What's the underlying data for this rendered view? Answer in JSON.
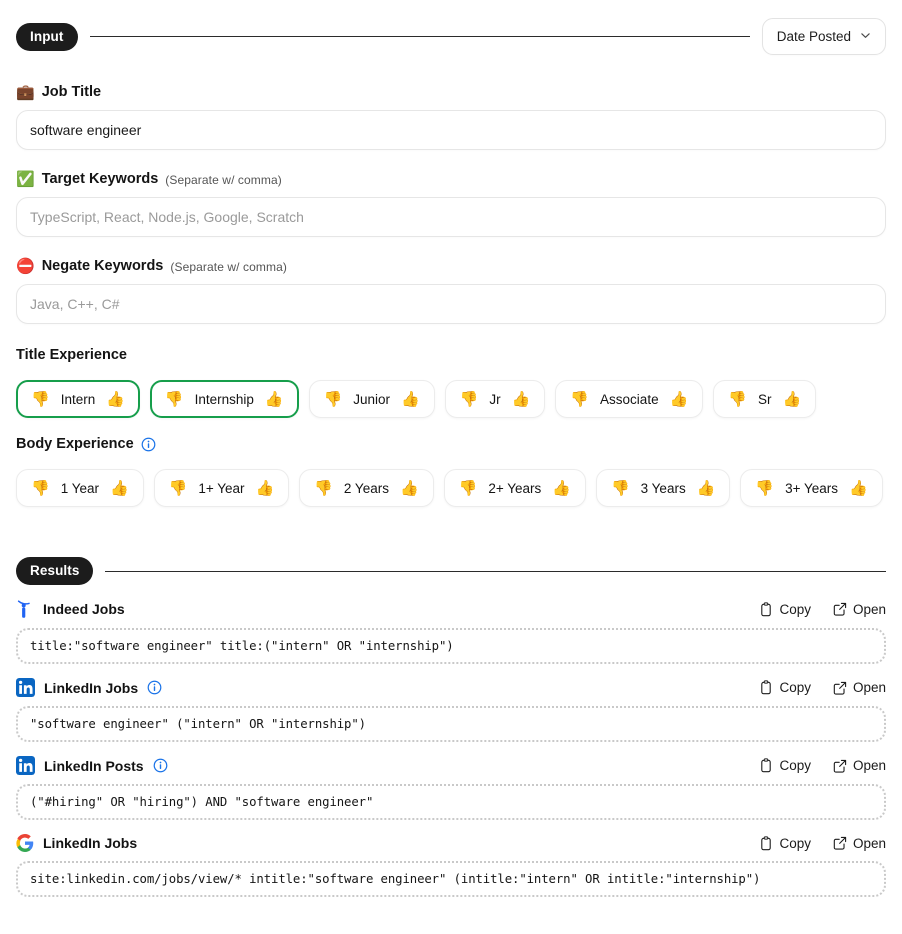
{
  "input_section": {
    "badge": "Input",
    "date_posted": {
      "label": "Date Posted",
      "icon": "chevron-down-icon"
    }
  },
  "fields": {
    "job_title": {
      "emoji": "💼",
      "label": "Job Title",
      "value": "software engineer",
      "placeholder": "software engineer"
    },
    "target_keywords": {
      "emoji": "✅",
      "label": "Target Keywords",
      "hint": "(Separate w/ comma)",
      "value": "",
      "placeholder": "TypeScript, React, Node.js, Google, Scratch"
    },
    "negate_keywords": {
      "emoji": "⛔",
      "label": "Negate Keywords",
      "hint": "(Separate w/ comma)",
      "value": "",
      "placeholder": "Java, C++, C#"
    }
  },
  "title_experience": {
    "label": "Title Experience",
    "thumb_down": "👎",
    "thumb_up": "👍",
    "chips": [
      {
        "label": "Intern",
        "selected": true
      },
      {
        "label": "Internship",
        "selected": true
      },
      {
        "label": "Junior",
        "selected": false
      },
      {
        "label": "Jr",
        "selected": false
      },
      {
        "label": "Associate",
        "selected": false
      },
      {
        "label": "Sr",
        "selected": false
      }
    ]
  },
  "body_experience": {
    "label": "Body Experience",
    "info_icon": "info-icon",
    "thumb_down": "👎",
    "thumb_up": "👍",
    "chips": [
      {
        "label": "1 Year",
        "selected": false
      },
      {
        "label": "1+ Year",
        "selected": false
      },
      {
        "label": "2 Years",
        "selected": false
      },
      {
        "label": "2+ Years",
        "selected": false
      },
      {
        "label": "3 Years",
        "selected": false
      },
      {
        "label": "3+ Years",
        "selected": false
      }
    ]
  },
  "results_section": {
    "badge": "Results",
    "copy_label": "Copy",
    "open_label": "Open",
    "copy_icon": "clipboard-icon",
    "open_icon": "external-link-icon",
    "items": [
      {
        "icon": "indeed-icon",
        "title": "Indeed Jobs",
        "has_info": false,
        "query": "title:\"software engineer\" title:(\"intern\" OR \"internship\")"
      },
      {
        "icon": "linkedin-icon",
        "title": "LinkedIn Jobs",
        "has_info": true,
        "query": "\"software engineer\" (\"intern\" OR \"internship\")"
      },
      {
        "icon": "linkedin-icon",
        "title": "LinkedIn Posts",
        "has_info": true,
        "query": "(\"#hiring\" OR \"hiring\") AND \"software engineer\""
      },
      {
        "icon": "google-icon",
        "title": "LinkedIn Jobs",
        "has_info": false,
        "query": "site:linkedin.com/jobs/view/* intitle:\"software engineer\" (intitle:\"intern\" OR intitle:\"internship\")"
      }
    ]
  },
  "colors": {
    "selected_border": "#169e4b",
    "badge_bg": "#1c1c1c",
    "linkedin_blue": "#0a66c2",
    "indeed_blue": "#2164f3",
    "info_blue": "#1a73e8"
  }
}
